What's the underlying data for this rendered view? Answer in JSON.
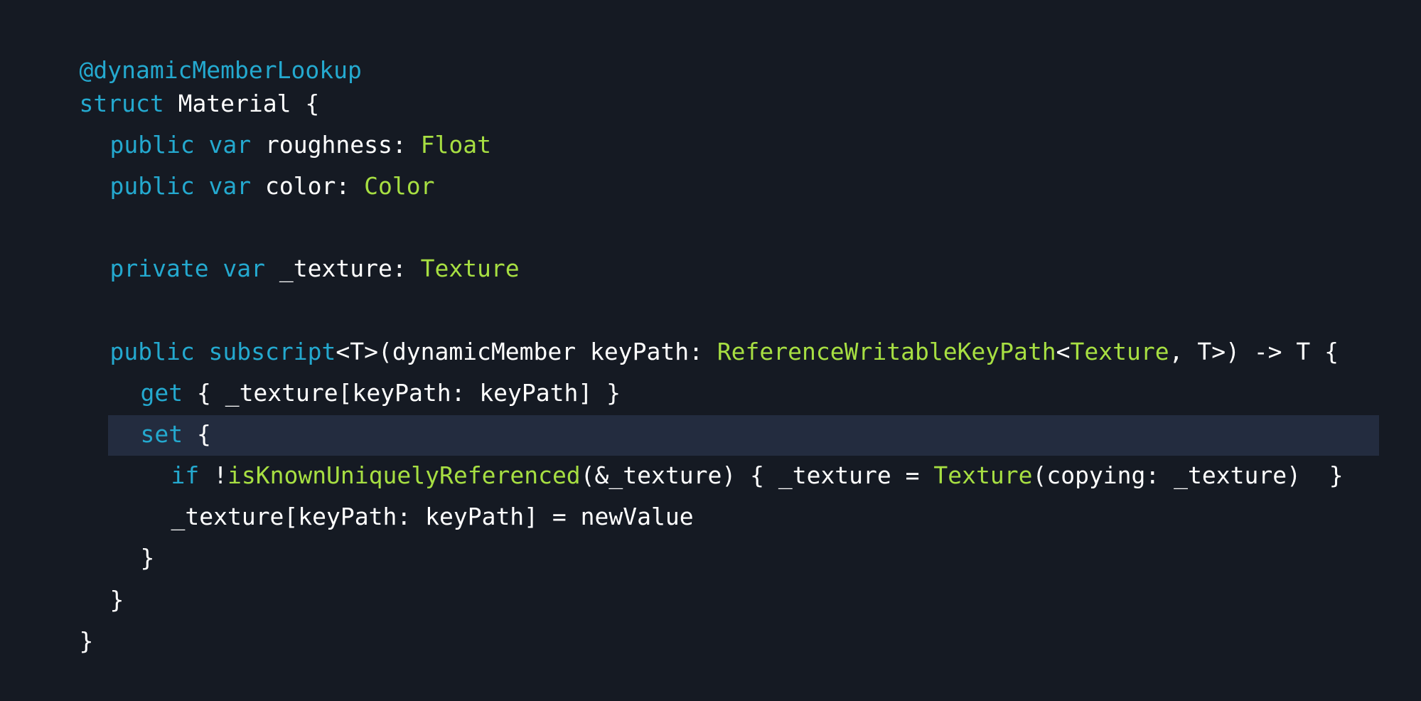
{
  "theme": {
    "background": "#151a23",
    "highlight": "#232c3f",
    "keyword_color": "#24a9cf",
    "type_color": "#a7df42",
    "text_color": "#ffffff"
  },
  "code": {
    "highlighted_line": 11,
    "lines": [
      {
        "tokens": [
          {
            "t": "@dynamicMemberLookup",
            "k": "keyword"
          }
        ]
      },
      {
        "tokens": [
          {
            "t": "struct",
            "k": "keyword"
          },
          {
            "t": " Material {",
            "k": "plain"
          }
        ]
      },
      {
        "tokens": [
          {
            "t": "public var",
            "k": "keyword"
          },
          {
            "t": " roughness: ",
            "k": "plain"
          },
          {
            "t": "Float",
            "k": "type"
          }
        ]
      },
      {
        "tokens": [
          {
            "t": "public var",
            "k": "keyword"
          },
          {
            "t": " color: ",
            "k": "plain"
          },
          {
            "t": "Color",
            "k": "type"
          }
        ]
      },
      {
        "tokens": []
      },
      {
        "tokens": [
          {
            "t": "private var",
            "k": "keyword"
          },
          {
            "t": " _texture: ",
            "k": "plain"
          },
          {
            "t": "Texture",
            "k": "type"
          }
        ]
      },
      {
        "tokens": []
      },
      {
        "tokens": [
          {
            "t": "public subscript",
            "k": "keyword"
          },
          {
            "t": "<T>(dynamicMember keyPath: ",
            "k": "plain"
          },
          {
            "t": "ReferenceWritableKeyPath",
            "k": "type"
          },
          {
            "t": "<",
            "k": "plain"
          },
          {
            "t": "Texture",
            "k": "type"
          },
          {
            "t": ", T>) -> T {",
            "k": "plain"
          }
        ]
      },
      {
        "tokens": [
          {
            "t": "get",
            "k": "keyword"
          },
          {
            "t": " { _texture[keyPath: keyPath] }",
            "k": "plain"
          }
        ]
      },
      {
        "tokens": [
          {
            "t": "set",
            "k": "keyword"
          },
          {
            "t": " {",
            "k": "plain"
          }
        ]
      },
      {
        "tokens": []
      },
      {
        "tokens": [
          {
            "t": "if",
            "k": "keyword"
          },
          {
            "t": " !",
            "k": "plain"
          },
          {
            "t": "isKnownUniquelyReferenced",
            "k": "type"
          },
          {
            "t": "(&_texture) { _texture = ",
            "k": "plain"
          },
          {
            "t": "Texture",
            "k": "type"
          },
          {
            "t": "(copying: _texture)  }",
            "k": "plain"
          }
        ]
      },
      {
        "tokens": [
          {
            "t": "_texture[keyPath: keyPath] = newValue",
            "k": "plain"
          }
        ]
      },
      {
        "tokens": [
          {
            "t": "}",
            "k": "plain"
          }
        ]
      },
      {
        "tokens": [
          {
            "t": "}",
            "k": "plain"
          }
        ]
      },
      {
        "tokens": [
          {
            "t": "}",
            "k": "plain"
          }
        ]
      }
    ]
  }
}
